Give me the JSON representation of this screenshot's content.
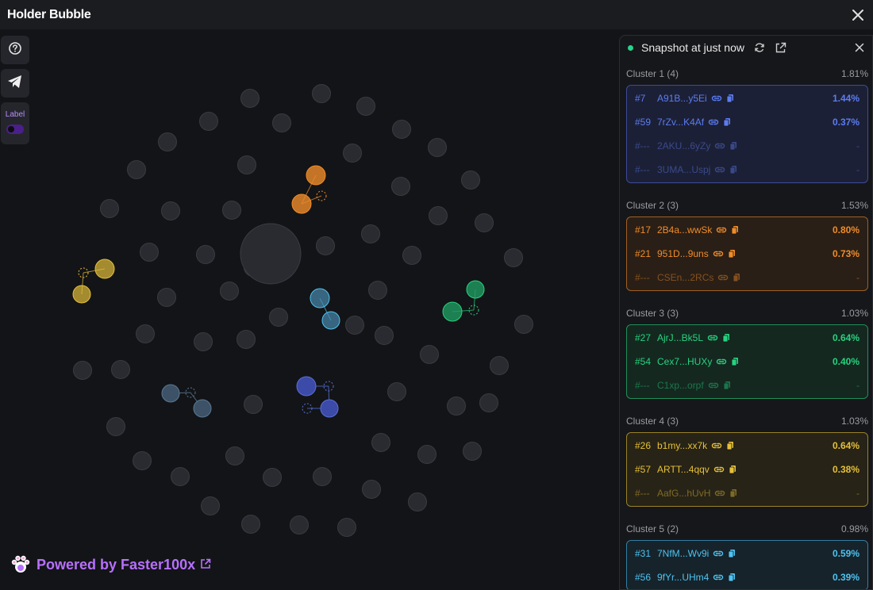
{
  "window": {
    "title": "Holder Bubble"
  },
  "toolbar": {
    "help_icon": "question-circle-icon",
    "telegram_icon": "telegram-icon",
    "label_text": "Label",
    "label_on": false
  },
  "footer": {
    "text": "Powered by Faster100x"
  },
  "panel": {
    "snapshot_text": "Snapshot at just now",
    "clusters": [
      {
        "name": "Cluster 1 (4)",
        "total": "1.81%",
        "color": "#5b7cf2",
        "bg": "#1c2036",
        "border": "#3c4a9a",
        "rows": [
          {
            "rank": "#7",
            "addr": "A91B...y5Ei",
            "pct": "1.44%",
            "dim": false
          },
          {
            "rank": "#59",
            "addr": "7rZv...K4Af",
            "pct": "0.37%",
            "dim": false
          },
          {
            "rank": "#---",
            "addr": "2AKU...6yZy",
            "pct": "-",
            "dim": true
          },
          {
            "rank": "#---",
            "addr": "3UMA...Uspj",
            "pct": "-",
            "dim": true
          }
        ]
      },
      {
        "name": "Cluster 2 (3)",
        "total": "1.53%",
        "color": "#f08c2a",
        "bg": "#2a1f16",
        "border": "#a05f22",
        "rows": [
          {
            "rank": "#17",
            "addr": "2B4a...wwSk",
            "pct": "0.80%",
            "dim": false
          },
          {
            "rank": "#21",
            "addr": "951D...9uns",
            "pct": "0.73%",
            "dim": false
          },
          {
            "rank": "#---",
            "addr": "CSEn...2RCs",
            "pct": "-",
            "dim": true
          }
        ]
      },
      {
        "name": "Cluster 3 (3)",
        "total": "1.03%",
        "color": "#27d37e",
        "bg": "#142820",
        "border": "#1f8f58",
        "rows": [
          {
            "rank": "#27",
            "addr": "AjrJ...Bk5L",
            "pct": "0.64%",
            "dim": false
          },
          {
            "rank": "#54",
            "addr": "Cex7...HUXy",
            "pct": "0.40%",
            "dim": false
          },
          {
            "rank": "#---",
            "addr": "C1xp...orpf",
            "pct": "-",
            "dim": true
          }
        ]
      },
      {
        "name": "Cluster 4 (3)",
        "total": "1.03%",
        "color": "#e6c03a",
        "bg": "#272316",
        "border": "#9a8226",
        "rows": [
          {
            "rank": "#26",
            "addr": "b1my...xx7k",
            "pct": "0.64%",
            "dim": false
          },
          {
            "rank": "#57",
            "addr": "ARTT...4qqv",
            "pct": "0.38%",
            "dim": false
          },
          {
            "rank": "#---",
            "addr": "AafG...hUvH",
            "pct": "-",
            "dim": true
          }
        ]
      },
      {
        "name": "Cluster 5 (2)",
        "total": "0.98%",
        "color": "#4ec3f0",
        "bg": "#16232b",
        "border": "#2f7fa3",
        "rows": [
          {
            "rank": "#31",
            "addr": "7NfM...Wv9i",
            "pct": "0.59%",
            "dim": false
          },
          {
            "rank": "#56",
            "addr": "9fYr...UHm4",
            "pct": "0.39%",
            "dim": false
          }
        ]
      }
    ]
  },
  "bubbles": {
    "grey_color": "#2a2b30",
    "grey_border": "#3a3b41",
    "large": {
      "color": "#2a2b30"
    }
  }
}
